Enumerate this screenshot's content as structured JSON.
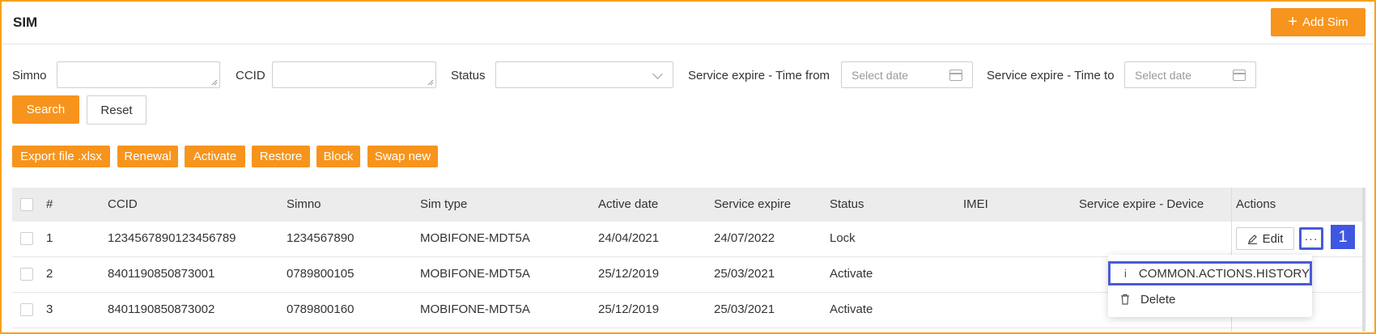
{
  "header": {
    "title": "SIM",
    "add_button": "Add Sim"
  },
  "filters": {
    "simno_label": "Simno",
    "ccid_label": "CCID",
    "status_label": "Status",
    "time_from_label": "Service expire - Time from",
    "time_from_placeholder": "Select date",
    "time_to_label": "Service expire - Time to",
    "time_to_placeholder": "Select date",
    "search_button": "Search",
    "reset_button": "Reset"
  },
  "actions": [
    "Export file .xlsx",
    "Renewal",
    "Activate",
    "Restore",
    "Block",
    "Swap new"
  ],
  "table": {
    "headers": [
      "#",
      "CCID",
      "Simno",
      "Sim type",
      "Active date",
      "Service expire",
      "Status",
      "IMEI",
      "Service expire - Device",
      "Actions"
    ],
    "rows": [
      [
        "1",
        "1234567890123456789",
        "1234567890",
        "MOBIFONE-MDT5A",
        "24/04/2021",
        "24/07/2022",
        "Lock",
        "",
        ""
      ],
      [
        "2",
        "8401190850873001",
        "0789800105",
        "MOBIFONE-MDT5A",
        "25/12/2019",
        "25/03/2021",
        "Activate",
        "",
        ""
      ],
      [
        "3",
        "8401190850873002",
        "0789800160",
        "MOBIFONE-MDT5A",
        "25/12/2019",
        "25/03/2021",
        "Activate",
        "",
        ""
      ]
    ],
    "row_actions": {
      "edit": "Edit",
      "more": "···"
    }
  },
  "badge": "1",
  "dropdown": {
    "history": "COMMON.ACTIONS.HISTORY",
    "delete": "Delete"
  },
  "colors": {
    "accent": "#f7941d",
    "highlight": "#4a5ad8",
    "badge": "#3f57e0"
  },
  "icons": {
    "add": "plus-icon",
    "select": "chevron-down-icon",
    "date": "calendar-icon",
    "edit": "pencil-icon",
    "info": "info-icon",
    "delete": "trash-icon"
  }
}
